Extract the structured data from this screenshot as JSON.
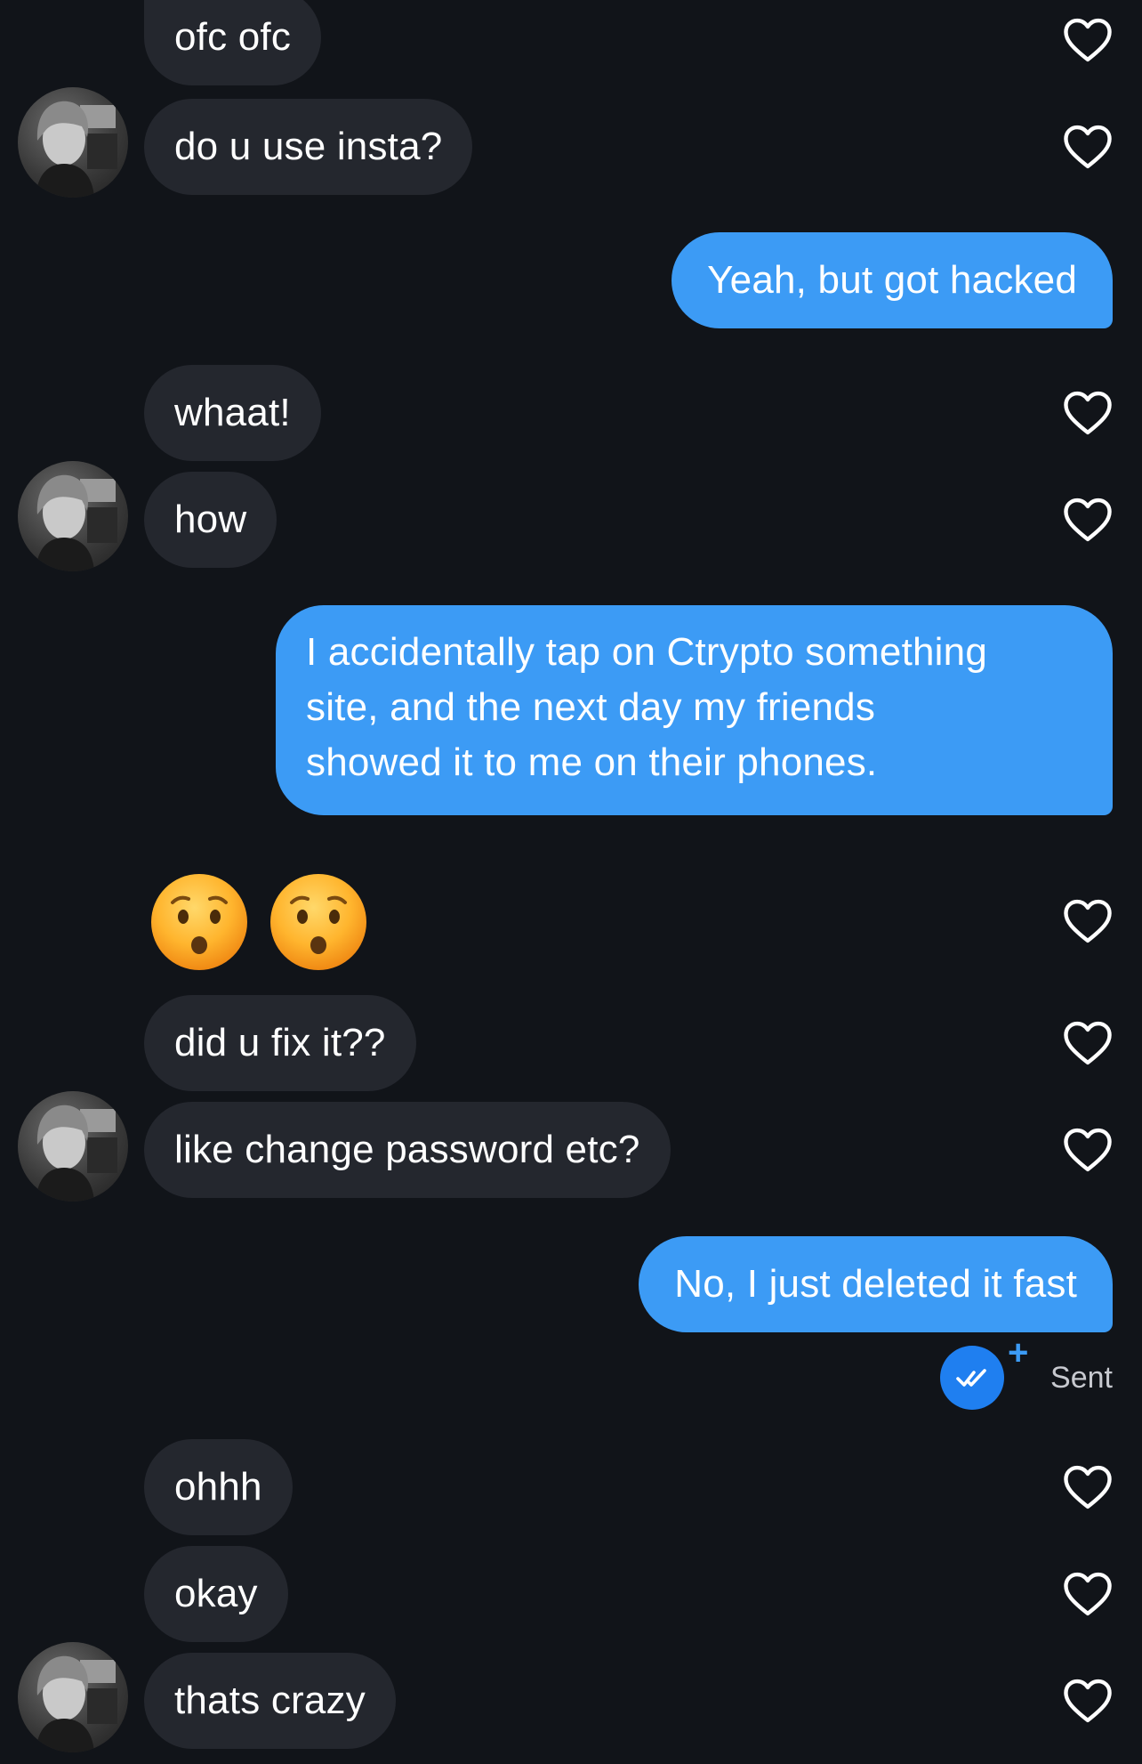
{
  "conversation": {
    "messages": [
      {
        "dir": "in",
        "text": "ofc ofc"
      },
      {
        "dir": "in",
        "text": "do u use insta?"
      },
      {
        "dir": "out",
        "text": "Yeah, but got hacked"
      },
      {
        "dir": "in",
        "text": "whaat!"
      },
      {
        "dir": "in",
        "text": "how"
      },
      {
        "dir": "out",
        "lines": [
          "I accidentally tap on Ctrypto something",
          "site, and the next day my friends",
          "showed it to me on their phones."
        ]
      },
      {
        "dir": "in",
        "emoji": "hushed-face",
        "emoji_count": 2
      },
      {
        "dir": "in",
        "text": "did u fix it??"
      },
      {
        "dir": "in",
        "text": "like change password etc?"
      },
      {
        "dir": "out",
        "text": "No, I just deleted it fast"
      },
      {
        "dir": "in",
        "text": "ohhh"
      },
      {
        "dir": "in",
        "text": "okay"
      },
      {
        "dir": "in",
        "text": "thats crazy"
      }
    ],
    "status": {
      "label": "Sent",
      "icon": "double-check-icon",
      "badge": "+"
    }
  },
  "colors": {
    "background": "#111419",
    "incoming_bubble": "#24272e",
    "outgoing_bubble": "#3c9bf5",
    "heart_outline": "#ffffff",
    "status_check": "#1f7ff0"
  },
  "icons": {
    "like": "heart-outline-icon",
    "avatar": "contact-avatar"
  }
}
